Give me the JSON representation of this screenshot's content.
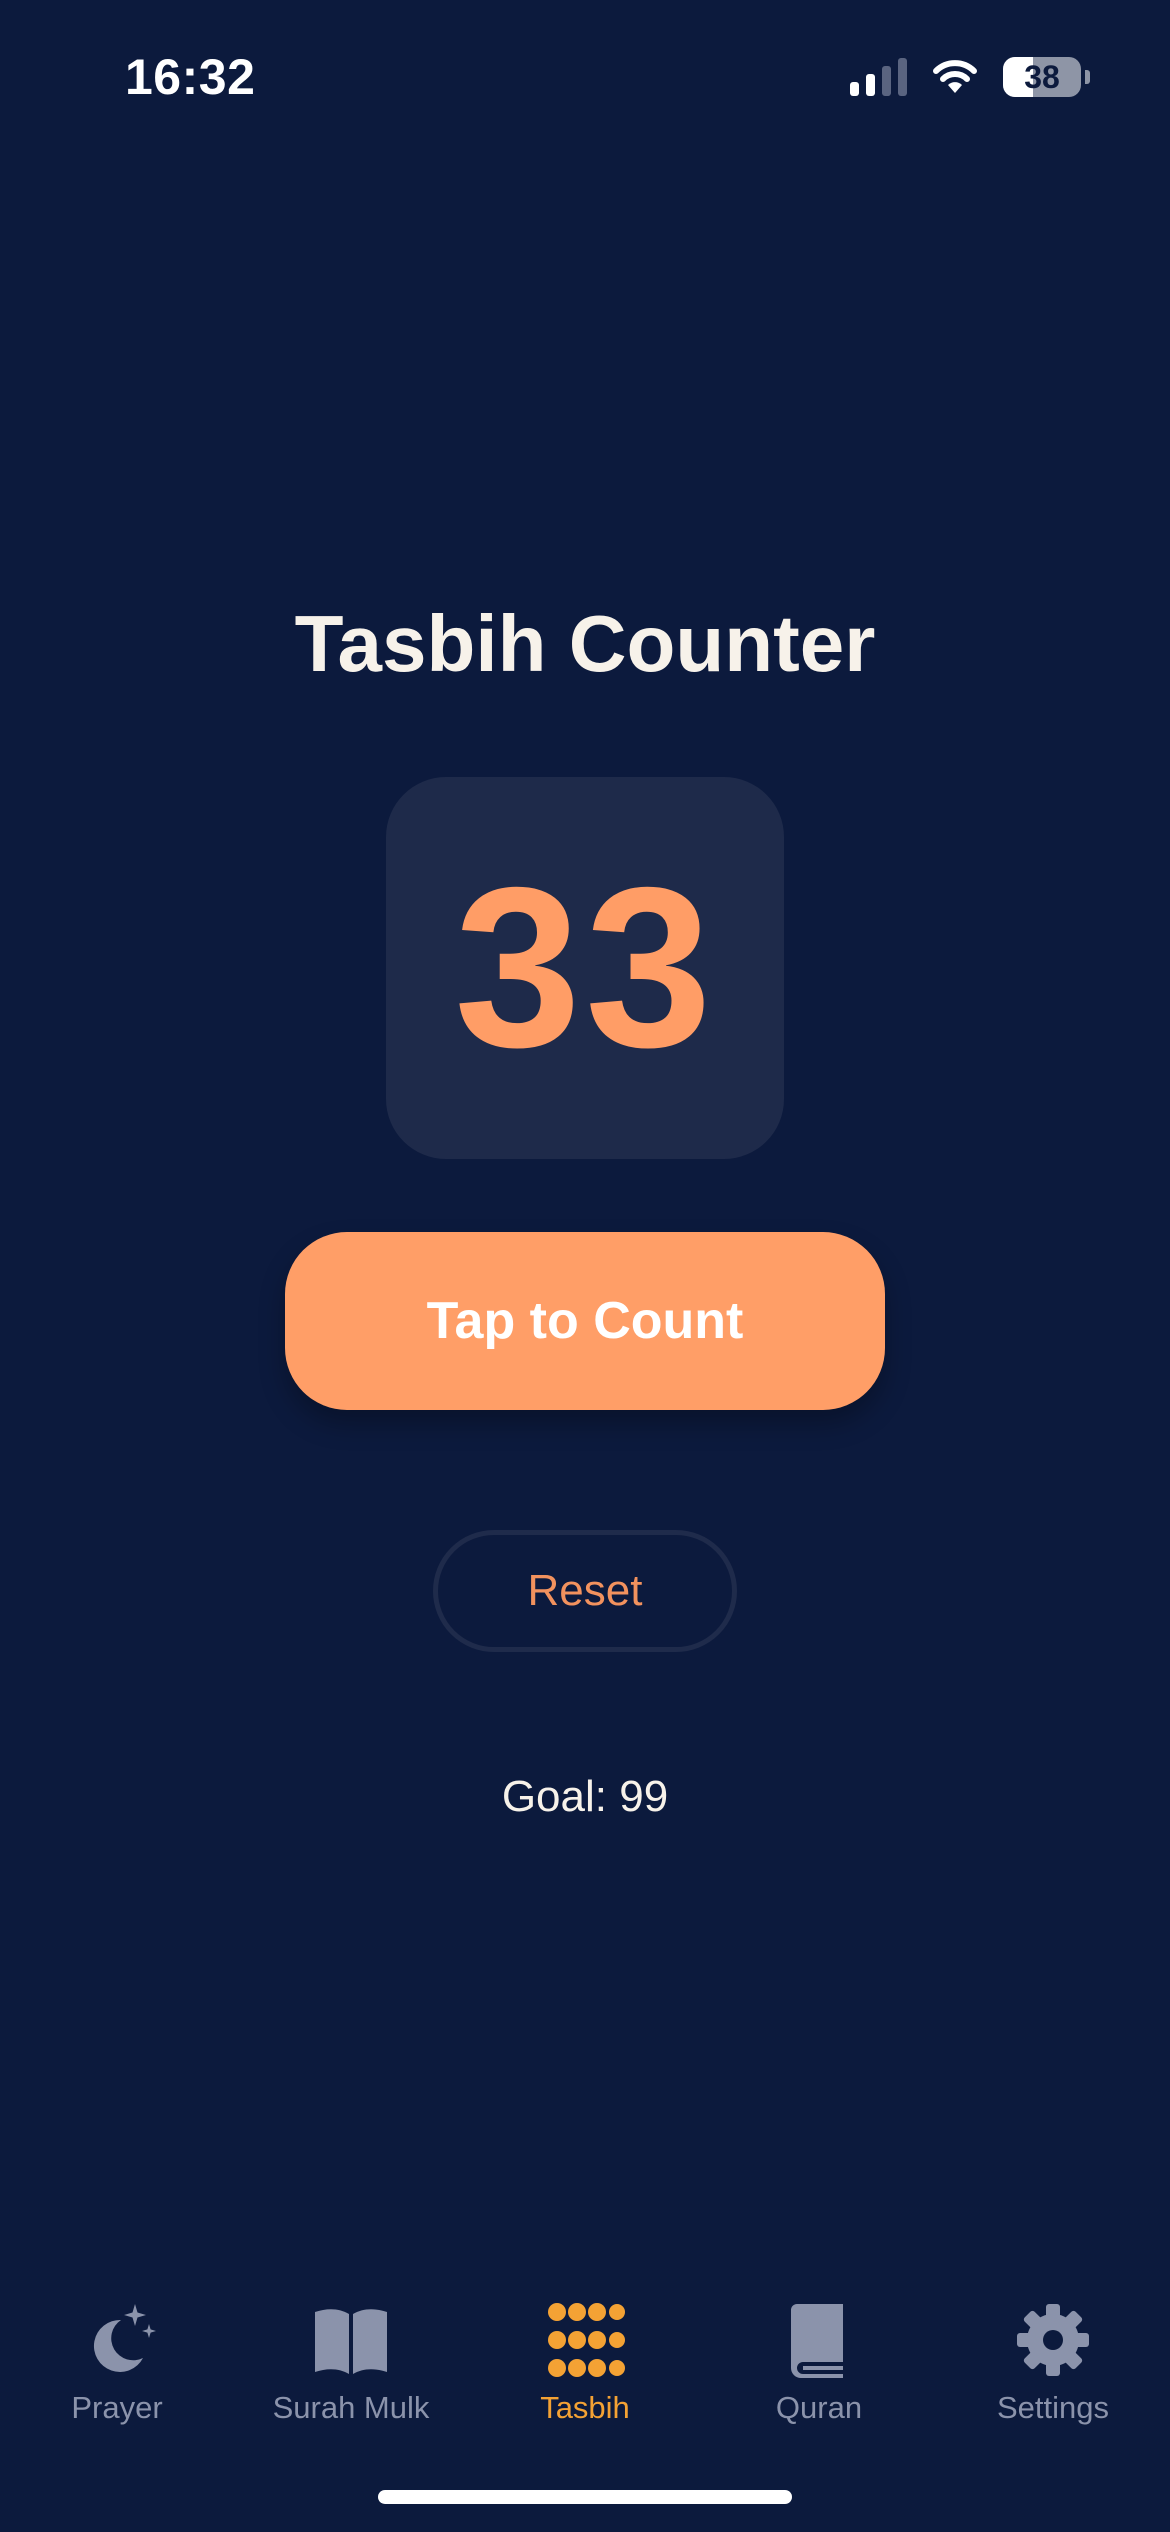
{
  "status_bar": {
    "time": "16:32",
    "battery_level": "38",
    "battery_fraction": 0.38,
    "signal_icon": "cellular-signal-icon",
    "wifi_icon": "wifi-icon"
  },
  "main": {
    "title": "Tasbih Counter",
    "count": "33",
    "tap_label": "Tap to Count",
    "reset_label": "Reset",
    "goal_text": "Goal: 99"
  },
  "tabs": [
    {
      "label": "Prayer",
      "icon": "moon-stars-icon",
      "active": false
    },
    {
      "label": "Surah Mulk",
      "icon": "open-book-icon",
      "active": false
    },
    {
      "label": "Tasbih",
      "icon": "dot-grid-icon",
      "active": true
    },
    {
      "label": "Quran",
      "icon": "closed-book-icon",
      "active": false
    },
    {
      "label": "Settings",
      "icon": "gear-icon",
      "active": false
    }
  ],
  "colors": {
    "background": "#0c1a3d",
    "accent": "#ff9e67",
    "counter_box": "#1e2a4a",
    "tab_active": "#f4a234",
    "tab_inactive": "#8b93ab"
  }
}
